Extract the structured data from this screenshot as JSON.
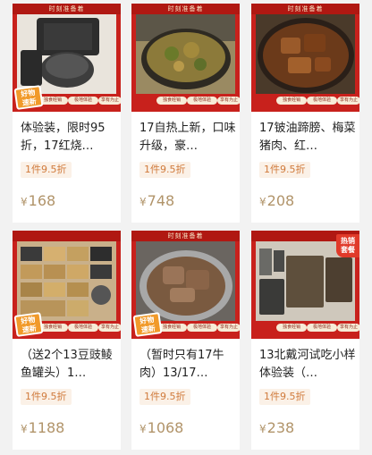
{
  "banner_text": "时刻准备着",
  "fresh_tag": [
    "好物",
    "速新"
  ],
  "hot_tag": [
    "热销",
    "套餐"
  ],
  "thumb_pills": [
    "独食经销",
    "极地体验",
    "享有为止"
  ],
  "currency": "¥",
  "products": [
    {
      "title": "体验装，限时95折，17红烧…",
      "discount": "1件9.5折",
      "price": "168",
      "photo_text": "红烧牛肉",
      "has_fresh": true,
      "has_hot": false,
      "photo_color": "#3a3a3a"
    },
    {
      "title": "17自热上新，口味升级，豪…",
      "discount": "1件9.5折",
      "price": "748",
      "photo_text": "",
      "has_fresh": false,
      "has_hot": false,
      "photo_color": "#8a7a3a"
    },
    {
      "title": "17铍油蹄膀、梅菜猪肉、红…",
      "discount": "1件9.5折",
      "price": "208",
      "photo_text": "",
      "has_fresh": false,
      "has_hot": false,
      "photo_color": "#6a3a1a"
    },
    {
      "title": "（送2个13豆豉鲮鱼罐头）1…",
      "discount": "1件9.5折",
      "price": "1188",
      "photo_text": "",
      "has_fresh": true,
      "has_hot": false,
      "photo_color": "#7a6a4a"
    },
    {
      "title": "（暂时只有17牛肉）13/17…",
      "discount": "1件9.5折",
      "price": "1068",
      "photo_text": "",
      "has_fresh": true,
      "has_hot": false,
      "photo_color": "#8a6a4a"
    },
    {
      "title": "13北戴河试吃小样体验装（…",
      "discount": "1件9.5折",
      "price": "238",
      "photo_text": "13单兵 自热食品",
      "has_fresh": false,
      "has_hot": true,
      "photo_color": "#4a4a48"
    }
  ]
}
